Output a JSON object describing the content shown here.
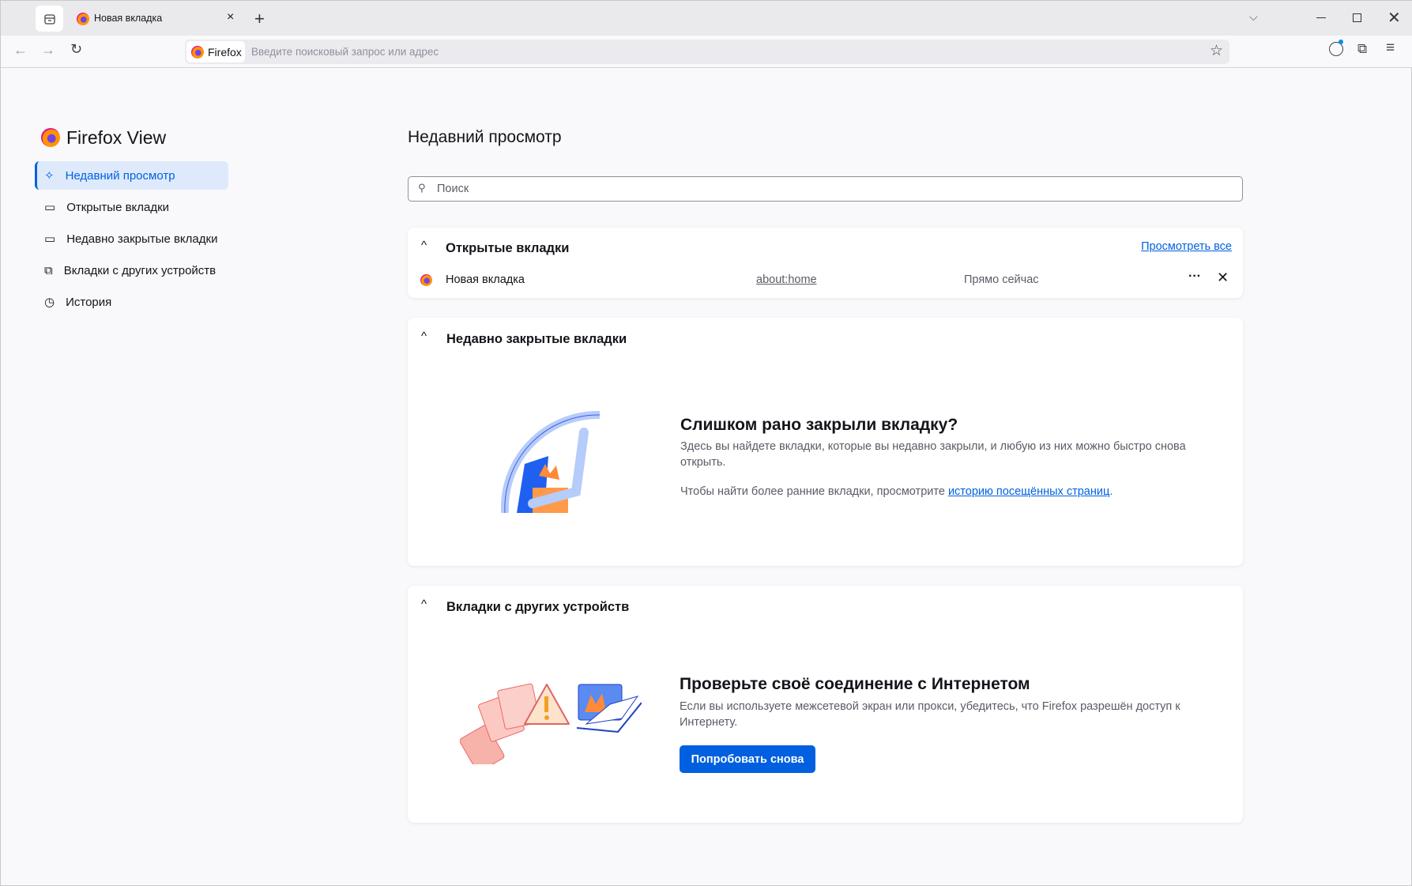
{
  "browser": {
    "tab_title": "Новая вкладка",
    "url_identity": "Firefox",
    "url_placeholder": "Введите поисковый запрос или адрес"
  },
  "sidebar": {
    "title": "Firefox View",
    "items": [
      {
        "label": "Недавний просмотр",
        "icon": "sparkle-icon",
        "active": true
      },
      {
        "label": "Открытые вкладки",
        "icon": "tab-icon"
      },
      {
        "label": "Недавно закрытые вкладки",
        "icon": "closed-tab-icon"
      },
      {
        "label": "Вкладки с других устройств",
        "icon": "synced-tabs-icon"
      },
      {
        "label": "История",
        "icon": "clock-icon"
      }
    ]
  },
  "main": {
    "title": "Недавний просмотр",
    "search_placeholder": "Поиск",
    "open_tabs": {
      "header": "Открытые вкладки",
      "view_all": "Просмотреть все",
      "rows": [
        {
          "title": "Новая вкладка",
          "url": "about:home",
          "time": "Прямо сейчас"
        }
      ]
    },
    "closed": {
      "header": "Недавно закрытые вкладки",
      "title": "Слишком рано закрыли вкладку?",
      "text": "Здесь вы найдете вкладки, которые вы недавно закрыли, и любую из них можно быстро снова открыть.",
      "text2_prefix": "Чтобы найти более ранние вкладки, просмотрите ",
      "text2_link": "историю посещённых страниц",
      "text2_suffix": "."
    },
    "synced": {
      "header": "Вкладки с других устройств",
      "title": "Проверьте своё соединение с Интернетом",
      "text": "Если вы используете межсетевой экран или прокси, убедитесь, что Firefox разрешён доступ к Интернету.",
      "button": "Попробовать снова"
    }
  },
  "colors": {
    "accent": "#0061e0",
    "button": "#0060df"
  }
}
